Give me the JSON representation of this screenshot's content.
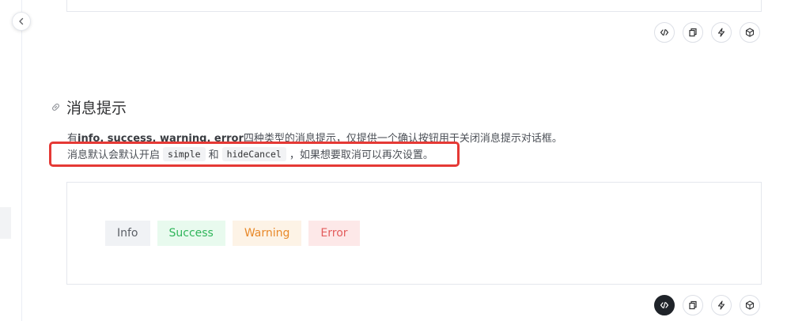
{
  "section": {
    "title": "消息提示",
    "desc_line1": {
      "prefix": "有",
      "t1": "info",
      "sep1": ", ",
      "t2": "success",
      "sep2": ", ",
      "t3": "warning",
      "sep3": ", ",
      "t4": "error",
      "suffix": "四种类型的消息提示，仅提供一个确认按钮用于关闭消息提示对话框。"
    },
    "desc_line2": {
      "part1": "消息默认会默认开启",
      "code1": "simple",
      "part2": "和",
      "code2": "hideCancel",
      "part3": "，如果想要取消可以再次设置。"
    }
  },
  "tags": [
    {
      "label": "Info",
      "type": "info"
    },
    {
      "label": "Success",
      "type": "success"
    },
    {
      "label": "Warning",
      "type": "warning"
    },
    {
      "label": "Error",
      "type": "error"
    }
  ],
  "toolbar_icons": [
    "code-icon",
    "copy-icon",
    "lightning-icon",
    "cube-icon"
  ],
  "colors": {
    "highlight_border": "#e53935",
    "success": "#2fb55a",
    "warning": "#e8892a",
    "error": "#e35d5d",
    "info": "#5b5f66"
  }
}
